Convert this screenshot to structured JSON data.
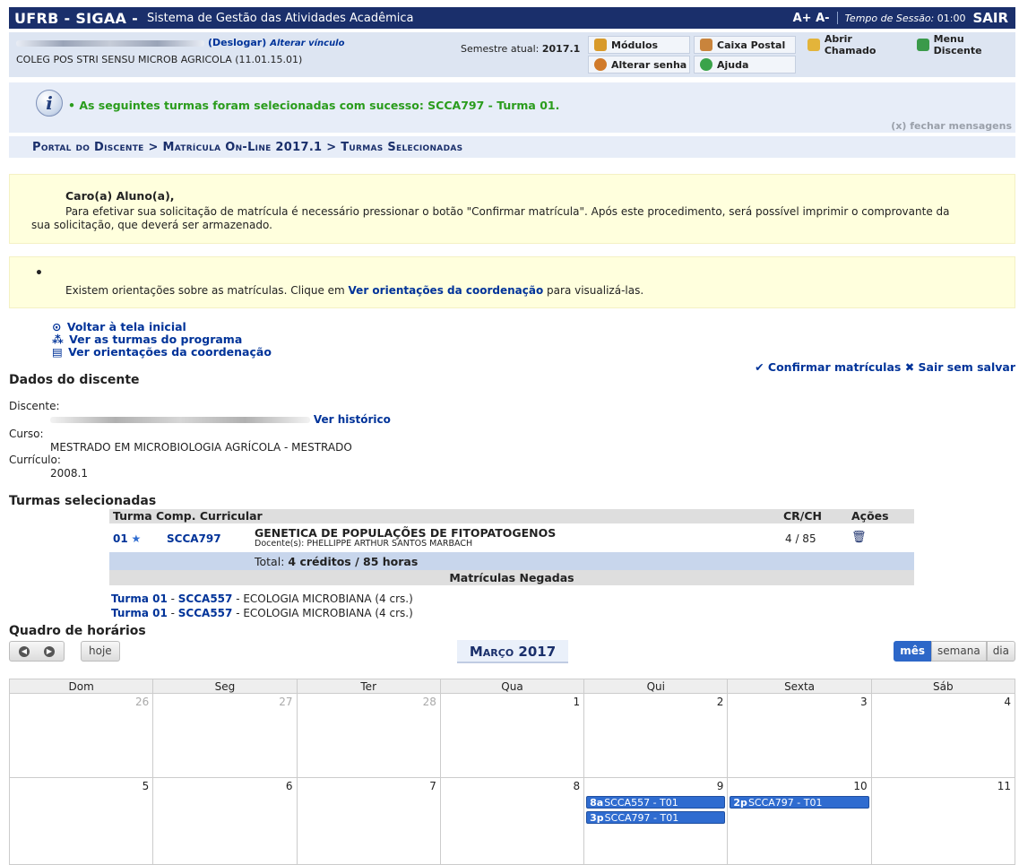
{
  "topbar": {
    "brand": "UFRB - SIGAA -",
    "system_name": "Sistema de Gestão das Atividades Acadêmica",
    "font_controls": "A+ A-",
    "session_label": "Tempo de Sessão:",
    "session_time": "01:00",
    "logout": "SAIR"
  },
  "user": {
    "deslogar": "(Deslogar)",
    "alterar_vinculo": "Alterar vínculo",
    "curso": "COLEG POS STRI SENSU MICROB AGRICOLA (11.01.15.01)",
    "semestre_label": "Semestre atual:",
    "semestre": "2017.1"
  },
  "toolbar": {
    "modulos": "Módulos",
    "caixa_postal": "Caixa Postal",
    "abrir_chamado": "Abrir Chamado",
    "menu_discente": "Menu Discente",
    "alterar_senha": "Alterar senha",
    "ajuda": "Ajuda"
  },
  "message": {
    "text": "• As seguintes turmas foram selecionadas com sucesso: SCCA797 - Turma 01.",
    "close": "(x) fechar mensagens"
  },
  "breadcrumb": "Portal do Discente > Matrícula On-Line 2017.1 > Turmas Selecionadas",
  "notice1": {
    "title": "Caro(a) Aluno(a),",
    "body": "Para efetivar sua solicitação de matrícula é necessário pressionar o botão \"Confirmar matrícula\". Após este procedimento, será possível imprimir o comprovante da sua solicitação, que deverá ser armazenado."
  },
  "notice2": {
    "bullet": "•",
    "body_before": "Existem orientações sobre as matrículas. Clique em ",
    "link": "Ver orientações da coordenação",
    "body_after": " para visualizá-las."
  },
  "links": {
    "voltar": "Voltar à tela inicial",
    "turmas_programa": "Ver as turmas do programa",
    "orientacoes": "Ver orientações da coordenação"
  },
  "actions": {
    "confirmar": "Confirmar matrículas",
    "sair": "Sair sem salvar"
  },
  "dados": {
    "title": "Dados do discente",
    "discente_label": "Discente:",
    "historico": "Ver histórico",
    "curso_label": "Curso:",
    "curso": "MESTRADO EM MICROBIOLOGIA AGRÍCOLA - MESTRADO",
    "curriculo_label": "Currículo:",
    "curriculo": "2008.1"
  },
  "turmas": {
    "title": "Turmas selecionadas",
    "headers": {
      "turma": "Turma",
      "comp": "Comp. Curricular",
      "crch": "CR/CH",
      "acoes": "Ações"
    },
    "row": {
      "turma": "01",
      "star": "★",
      "code": "SCCA797",
      "name": "GENETICA DE POPULAÇÕES DE FITOPATOGENOS",
      "docente": "Docente(s): PHELLIPPE ARTHUR SANTOS MARBACH",
      "crch": "4 / 85"
    },
    "total_label": "Total:",
    "total_value": "4 créditos / 85 horas",
    "negadas_title": "Matrículas Negadas",
    "negadas": [
      {
        "turma": "Turma 01",
        "code": "SCCA557",
        "desc": " - ECOLOGIA MICROBIANA (4 crs.)"
      },
      {
        "turma": "Turma 01",
        "code": "SCCA557",
        "desc": " - ECOLOGIA MICROBIANA (4 crs.)"
      }
    ]
  },
  "calendar": {
    "title": "Quadro de horários",
    "hoje": "hoje",
    "month": "Março 2017",
    "views": [
      "mês",
      "semana",
      "dia"
    ],
    "weekdays": [
      "Dom",
      "Seg",
      "Ter",
      "Qua",
      "Qui",
      "Sexta",
      "Sáb"
    ],
    "weeks": [
      [
        "26",
        "27",
        "28",
        "1",
        "2",
        "3",
        "4"
      ],
      [
        "5",
        "6",
        "7",
        "8",
        "9",
        "10",
        "11"
      ]
    ],
    "events": {
      "e1": {
        "time": "8a",
        "label": "SCCA557 - T01"
      },
      "e2": {
        "time": "3p",
        "label": "SCCA797 - T01"
      },
      "e3": {
        "time": "2p",
        "label": "SCCA797 - T01"
      }
    }
  },
  "colors": {
    "topbar": "#1a2f6b",
    "message_text": "#2a9c1c",
    "event": "#2f6cd0",
    "link": "#003399"
  }
}
